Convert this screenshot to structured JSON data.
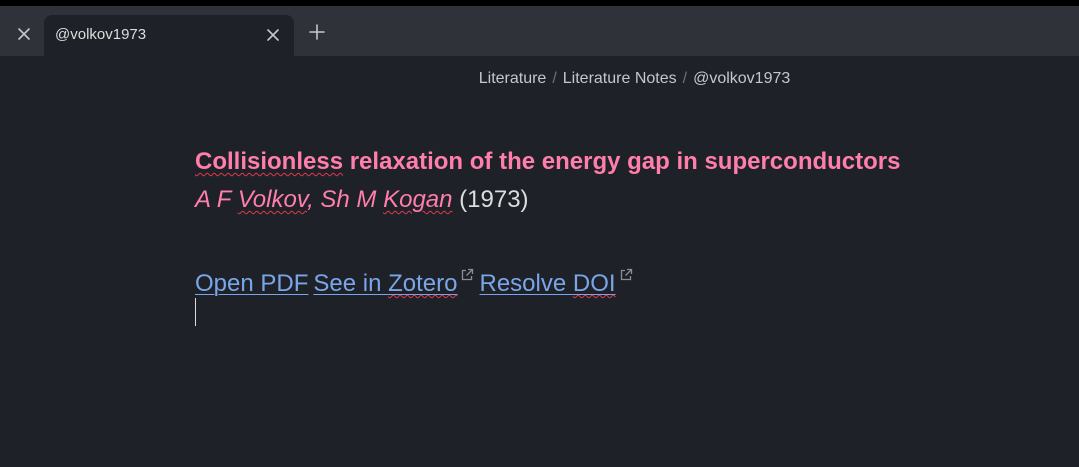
{
  "tabbar": {
    "active_tab": {
      "title": "@volkov1973"
    }
  },
  "breadcrumb": {
    "items": [
      "Literature",
      "Literature Notes",
      "@volkov1973"
    ],
    "separator": "/"
  },
  "note": {
    "title_word_1": "Collisionless",
    "title_rest": " relaxation of the energy gap in superconductors",
    "author_a": "A F ",
    "author_volkov": "Volkov",
    "author_sep": ", Sh M ",
    "author_kogan": "Kogan",
    "year": " (1973)",
    "links": {
      "open_pdf": "Open PDF",
      "zotero_prefix": "See in ",
      "zotero_word": "Zotero",
      "doi_prefix": "Resolve ",
      "doi_word": "DOI"
    }
  },
  "colors": {
    "background": "#1e2127",
    "tabbar": "#2f3238",
    "title_pink": "#ff7eaa",
    "link_blue": "#7aa6e8",
    "spellcheck_red": "#e0394b"
  },
  "icons": [
    "close-icon",
    "plus-icon",
    "external-link-icon"
  ]
}
